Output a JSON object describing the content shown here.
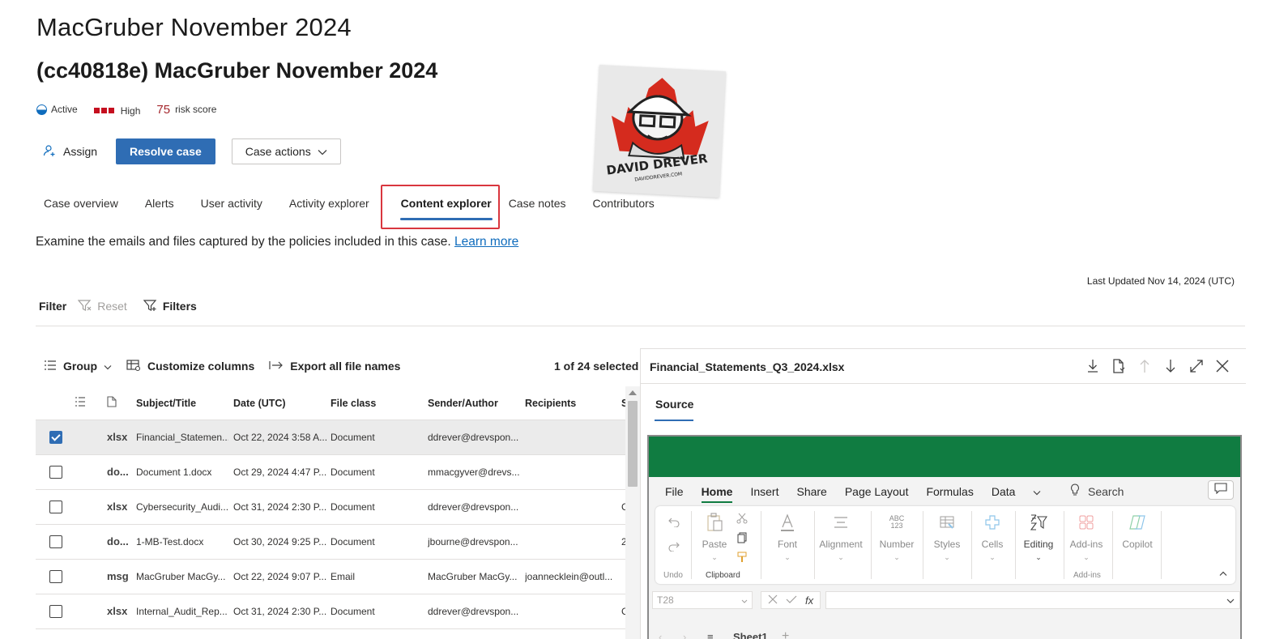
{
  "header": {
    "title": "MacGruber November 2024",
    "subtitle": "(cc40818e) MacGruber November 2024",
    "status": "Active",
    "severity": "High",
    "risk_score_value": "75",
    "risk_score_label": "risk score"
  },
  "actions": {
    "assign": "Assign",
    "resolve": "Resolve case",
    "case_actions": "Case actions"
  },
  "logo": {
    "brand_text": "DAVID DREVER",
    "url_text": "DAVIDDREVER.COM"
  },
  "tabs": [
    {
      "label": "Case overview"
    },
    {
      "label": "Alerts"
    },
    {
      "label": "User activity"
    },
    {
      "label": "Activity explorer"
    },
    {
      "label": "Content explorer"
    },
    {
      "label": "Case notes"
    },
    {
      "label": "Contributors"
    }
  ],
  "description": {
    "text": "Examine the emails and files captured by the policies included in this case.",
    "link": "Learn more"
  },
  "last_updated": "Last Updated Nov 14, 2024 (UTC)",
  "filter": {
    "label": "Filter",
    "reset": "Reset",
    "filters": "Filters"
  },
  "table_toolbar": {
    "group": "Group",
    "customize": "Customize columns",
    "export": "Export all file names",
    "selected": "1 of 24 selected"
  },
  "table": {
    "headers": {
      "subject": "Subject/Title",
      "date": "Date (UTC)",
      "file_class": "File class",
      "sender": "Sender/Author",
      "recipients": "Recipients",
      "extra": "S"
    },
    "rows": [
      {
        "ext": "xlsx",
        "subject": "Financial_Statemen...",
        "date": "Oct 22, 2024 3:58 A...",
        "class": "Document",
        "sender": "ddrever@drevspon...",
        "recipients": "",
        "extra": "",
        "checked": true
      },
      {
        "ext": "do...",
        "subject": "Document 1.docx",
        "date": "Oct 29, 2024 4:47 P...",
        "class": "Document",
        "sender": "mmacgyver@drevs...",
        "recipients": "",
        "extra": "",
        "checked": false
      },
      {
        "ext": "xlsx",
        "subject": "Cybersecurity_Audi...",
        "date": "Oct 31, 2024 2:30 P...",
        "class": "Document",
        "sender": "ddrever@drevspon...",
        "recipients": "",
        "extra": "C",
        "checked": false
      },
      {
        "ext": "do...",
        "subject": "1-MB-Test.docx",
        "date": "Oct 30, 2024 9:25 P...",
        "class": "Document",
        "sender": "jbourne@drevspon...",
        "recipients": "",
        "extra": "2",
        "checked": false
      },
      {
        "ext": "msg",
        "subject": "MacGruber MacGy...",
        "date": "Oct 22, 2024 9:07 P...",
        "class": "Email",
        "sender": "MacGruber MacGy...",
        "recipients": "joannecklein@outl...",
        "extra": "",
        "checked": false
      },
      {
        "ext": "xlsx",
        "subject": "Internal_Audit_Rep...",
        "date": "Oct 31, 2024 2:30 P...",
        "class": "Document",
        "sender": "ddrever@drevspon...",
        "recipients": "",
        "extra": "C",
        "checked": false
      }
    ]
  },
  "preview": {
    "title": "Financial_Statements_Q3_2024.xlsx",
    "tab": "Source",
    "excel": {
      "menu": [
        "File",
        "Home",
        "Insert",
        "Share",
        "Page Layout",
        "Formulas",
        "Data"
      ],
      "search": "Search",
      "ribbon": {
        "undo": "Undo",
        "paste": "Paste",
        "clipboard": "Clipboard",
        "font": "Font",
        "alignment": "Alignment",
        "number": "Number",
        "styles": "Styles",
        "cells": "Cells",
        "editing": "Editing",
        "addins": "Add-ins",
        "addins_group": "Add-ins",
        "copilot": "Copilot"
      },
      "namebox": "T28",
      "fx": "fx",
      "sheet": "Sheet1"
    }
  },
  "colors": {
    "accent": "#2f6db4",
    "excel_green": "#107c41",
    "severity": "#c50f1f",
    "highlight": "#d9363e"
  }
}
